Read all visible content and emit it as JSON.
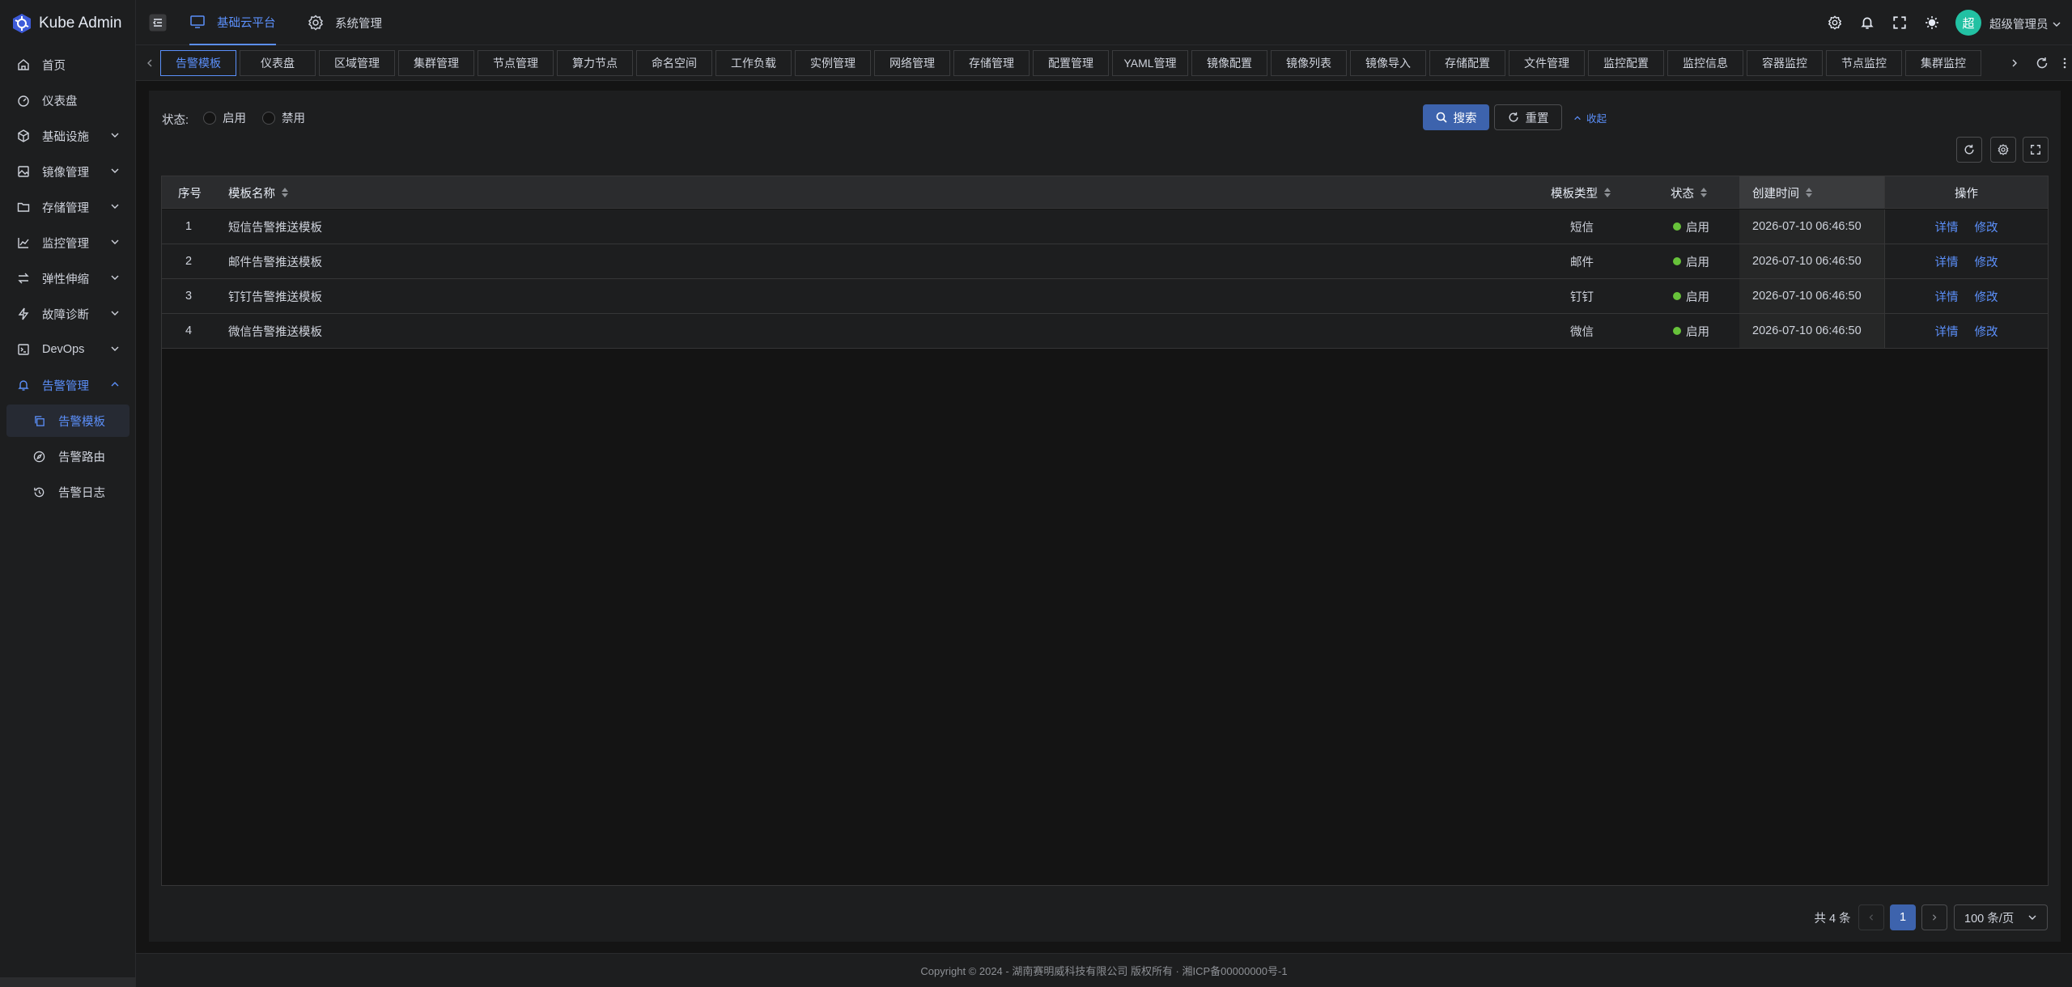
{
  "app": {
    "title": "Kube Admin"
  },
  "header": {
    "menus": [
      {
        "label": "基础云平台",
        "icon": "monitor-icon"
      },
      {
        "label": "系统管理",
        "icon": "gear-icon"
      }
    ],
    "avatar_text": "超",
    "username": "超级管理员"
  },
  "sidebar": {
    "items": [
      {
        "label": "首页",
        "icon": "home-icon"
      },
      {
        "label": "仪表盘",
        "icon": "dashboard-icon"
      },
      {
        "label": "基础设施",
        "icon": "cube-icon"
      },
      {
        "label": "镜像管理",
        "icon": "image-icon"
      },
      {
        "label": "存储管理",
        "icon": "folder-icon"
      },
      {
        "label": "监控管理",
        "icon": "chart-icon"
      },
      {
        "label": "弹性伸缩",
        "icon": "arrows-icon"
      },
      {
        "label": "故障诊断",
        "icon": "bolt-icon"
      },
      {
        "label": "DevOps",
        "icon": "devops-icon"
      },
      {
        "label": "告警管理",
        "icon": "bell-icon"
      }
    ],
    "sub_items": [
      {
        "label": "告警模板",
        "icon": "copy-icon"
      },
      {
        "label": "告警路由",
        "icon": "compass-icon"
      },
      {
        "label": "告警日志",
        "icon": "history-icon"
      }
    ]
  },
  "tabs": [
    "告警模板",
    "仪表盘",
    "区域管理",
    "集群管理",
    "节点管理",
    "算力节点",
    "命名空间",
    "工作负载",
    "实例管理",
    "网络管理",
    "存储管理",
    "配置管理",
    "YAML管理",
    "镜像配置",
    "镜像列表",
    "镜像导入",
    "存储配置",
    "文件管理",
    "监控配置",
    "监控信息",
    "容器监控",
    "节点监控",
    "集群监控"
  ],
  "filter": {
    "status_label": "状态:",
    "options": [
      "启用",
      "禁用"
    ],
    "search_label": "搜索",
    "reset_label": "重置",
    "collapse_label": "收起"
  },
  "table": {
    "columns": {
      "index": "序号",
      "name": "模板名称",
      "type": "模板类型",
      "status": "状态",
      "created": "创建时间",
      "actions": "操作"
    },
    "rows": [
      {
        "index": "1",
        "name": "短信告警推送模板",
        "type": "短信",
        "status": "启用",
        "created": "2026-07-10 06:46:50"
      },
      {
        "index": "2",
        "name": "邮件告警推送模板",
        "type": "邮件",
        "status": "启用",
        "created": "2026-07-10 06:46:50"
      },
      {
        "index": "3",
        "name": "钉钉告警推送模板",
        "type": "钉钉",
        "status": "启用",
        "created": "2026-07-10 06:46:50"
      },
      {
        "index": "4",
        "name": "微信告警推送模板",
        "type": "微信",
        "status": "启用",
        "created": "2026-07-10 06:46:50"
      }
    ],
    "detail_label": "详情",
    "edit_label": "修改"
  },
  "pagination": {
    "total_text": "共 4 条",
    "current_page": "1",
    "page_size": "100 条/页"
  },
  "footer": {
    "text": "Copyright © 2024 - 湖南赛明威科技有限公司 版权所有 · 湘ICP备00000000号-1"
  },
  "colors": {
    "accent": "#5b8ff9",
    "primary_button": "#3d63ad",
    "status_ok": "#67c23a",
    "avatar": "#22c1a3"
  }
}
